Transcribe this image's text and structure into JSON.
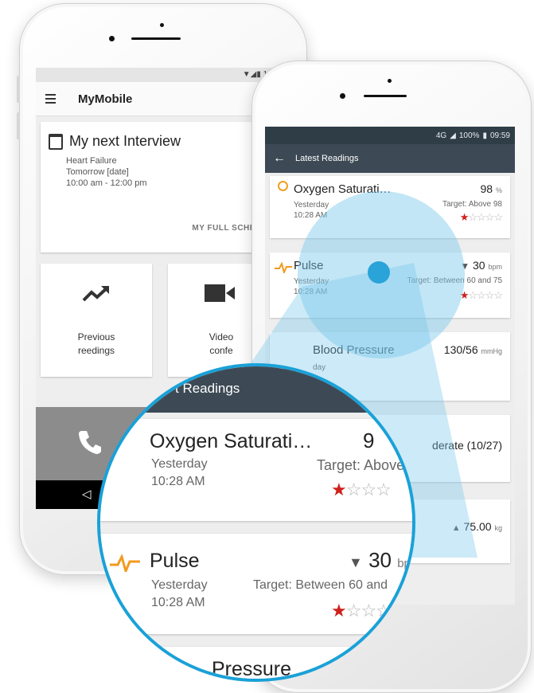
{
  "back_phone": {
    "status_text": "1:",
    "app_title": "MyMobile",
    "interview": {
      "title": "My next Interview",
      "condition": "Heart Failure",
      "date": "Tomorrow [date]",
      "time": "10:00 am - 12:00 pm",
      "schedule_link": "MY FULL SCHEDUL"
    },
    "tiles": [
      {
        "label_line1": "Previous",
        "label_line2": "reedings"
      },
      {
        "label_line1": "Video",
        "label_line2": "confe"
      }
    ],
    "nav_back": "◁"
  },
  "front_phone": {
    "status": {
      "signal": "4G",
      "battery": "100%",
      "time": "09:59"
    },
    "toolbar_title": "Latest Readings",
    "readings": [
      {
        "name": "Oxygen Saturati…",
        "day": "Yesterday",
        "time": "10:28 AM",
        "value": "98",
        "unit": "%",
        "target": "Target: Above 98",
        "stars": 1
      },
      {
        "name": "Pulse",
        "day": "Yesterday",
        "time": "10:28 AM",
        "trend": "▼",
        "value": "30",
        "unit": "bpm",
        "target": "Target: Between 60 and 75",
        "stars": 1
      },
      {
        "name": "Blood Pressure",
        "day": "day",
        "value": "130/56",
        "unit": "mmHg"
      },
      {
        "value": "derate (10/27)"
      },
      {
        "trend": "▲",
        "value": "75.00",
        "unit": "kg"
      }
    ]
  },
  "magnifier": {
    "toolbar_title": "t Readings",
    "oxygen": {
      "name": "Oxygen Saturati…",
      "day": "Yesterday",
      "time": "10:28 AM",
      "value_partial": "9",
      "target": "Target: Above"
    },
    "pulse": {
      "name": "Pulse",
      "day": "Yesterday",
      "time": "10:28 AM",
      "trend": "▼",
      "value": "30",
      "unit": "bpr",
      "target": "Target: Between 60 and"
    },
    "bp_partial": "Pressure"
  },
  "colors": {
    "accent": "#1aa1d8",
    "toolbar": "#3d4a55",
    "star_on": "#d0201b",
    "pulse": "#f39a1e"
  }
}
